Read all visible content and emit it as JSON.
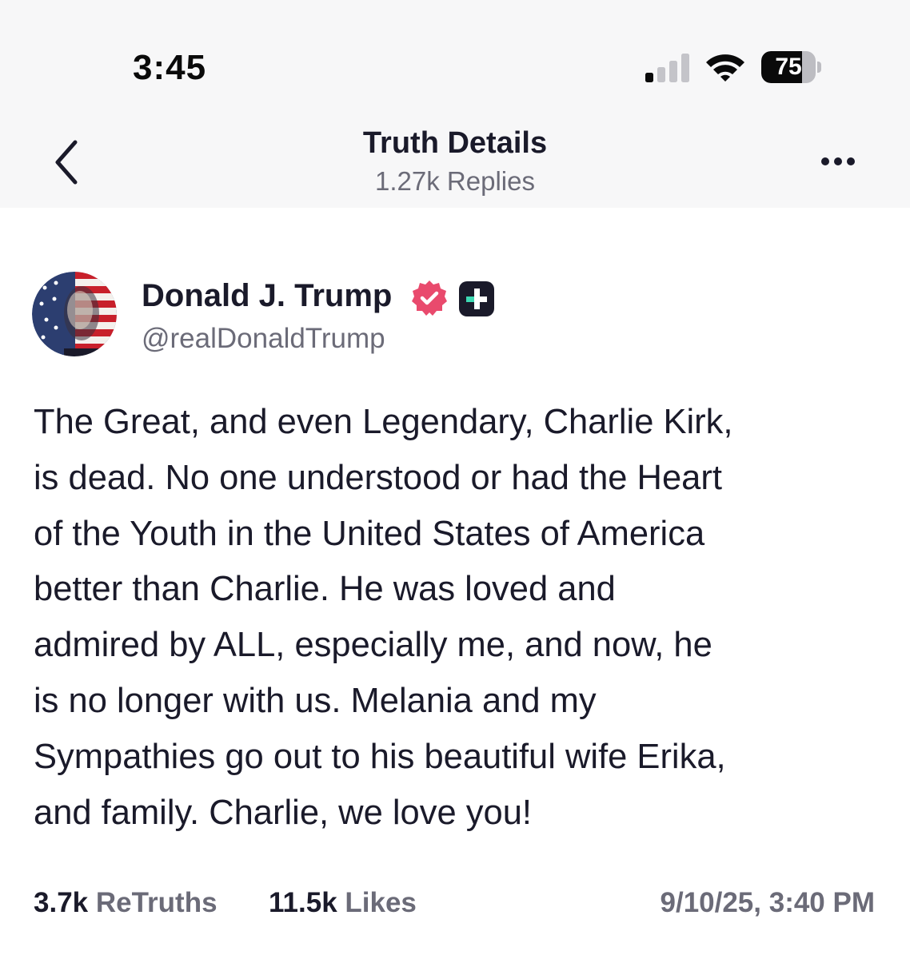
{
  "status_bar": {
    "time": "3:45",
    "signal_bars_active": 1,
    "signal_bars_total": 4,
    "wifi": "wifi-icon",
    "battery_level": "75",
    "battery_fraction": 0.75
  },
  "header": {
    "back_icon": "chevron-left-icon",
    "title": "Truth Details",
    "subtitle": "1.27k Replies",
    "more_icon": "ellipsis-icon"
  },
  "author": {
    "name": "Donald J. Trump",
    "handle": "@realDonaldTrump",
    "verified_icon": "verified-badge-icon",
    "verified_color": "#e94a6d",
    "plus_icon": "truth-plus-icon",
    "plus_color": "#1a1a2a"
  },
  "post": {
    "text": "The Great, and even Legendary, Charlie Kirk,\nis dead. No one understood or had the Heart\nof the Youth in the United States of America\nbetter than Charlie. He was loved and\nadmired by ALL, especially me, and now, he\nis no longer with us. Melania and my\nSympathies go out to his beautiful wife Erika,\nand family. Charlie, we love you!"
  },
  "stats": {
    "retruths_count": "3.7k",
    "retruths_label": "ReTruths",
    "likes_count": "11.5k",
    "likes_label": "Likes",
    "timestamp": "9/10/25, 3:40 PM"
  },
  "colors": {
    "text_primary": "#1a1a2a",
    "text_secondary": "#6b6b78",
    "header_bg": "#f7f7f8"
  }
}
